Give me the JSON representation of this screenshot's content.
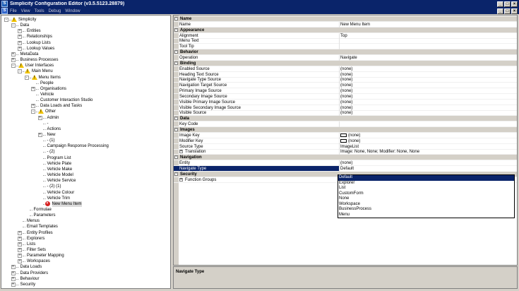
{
  "window": {
    "title": "Simplicity Configuration Editor (v3.5.5123.28879)",
    "menu": [
      "File",
      "View",
      "Tools",
      "Debug",
      "Window"
    ]
  },
  "tree": [
    {
      "label": "Simplicity",
      "indent": 0,
      "exp": "-",
      "icon": "warn"
    },
    {
      "label": "Data",
      "indent": 1,
      "exp": "-",
      "icon": ""
    },
    {
      "label": "Entities",
      "indent": 2,
      "exp": "+",
      "icon": ""
    },
    {
      "label": "Relationships",
      "indent": 2,
      "exp": "+",
      "icon": ""
    },
    {
      "label": "Lookup Lists",
      "indent": 2,
      "exp": "+",
      "icon": ""
    },
    {
      "label": "Lookup Values",
      "indent": 2,
      "exp": "+",
      "icon": ""
    },
    {
      "label": "MetaData",
      "indent": 1,
      "exp": "+",
      "icon": ""
    },
    {
      "label": "Business Processes",
      "indent": 1,
      "exp": "+",
      "icon": ""
    },
    {
      "label": "User Interfaces",
      "indent": 1,
      "exp": "-",
      "icon": "warn"
    },
    {
      "label": "Main Menu",
      "indent": 2,
      "exp": "-",
      "icon": "warn"
    },
    {
      "label": "Menu Items",
      "indent": 3,
      "exp": "-",
      "icon": "warn"
    },
    {
      "label": "People",
      "indent": 4,
      "exp": "",
      "icon": ""
    },
    {
      "label": "Organisations",
      "indent": 4,
      "exp": "+",
      "icon": ""
    },
    {
      "label": "Vehicle",
      "indent": 4,
      "exp": "",
      "icon": ""
    },
    {
      "label": "Customer Interaction Studio",
      "indent": 4,
      "exp": "",
      "icon": ""
    },
    {
      "label": "Data Loads and Tasks",
      "indent": 4,
      "exp": "+",
      "icon": ""
    },
    {
      "label": "Other",
      "indent": 4,
      "exp": "-",
      "icon": "warn"
    },
    {
      "label": "Admin",
      "indent": 5,
      "exp": "+",
      "icon": ""
    },
    {
      "label": "-",
      "indent": 5,
      "exp": "",
      "icon": ""
    },
    {
      "label": "Actions",
      "indent": 5,
      "exp": "",
      "icon": ""
    },
    {
      "label": "New",
      "indent": 5,
      "exp": "+",
      "icon": ""
    },
    {
      "label": "- (1)",
      "indent": 5,
      "exp": "",
      "icon": ""
    },
    {
      "label": "Campaign Response Processing",
      "indent": 5,
      "exp": "",
      "icon": ""
    },
    {
      "label": "- (2)",
      "indent": 5,
      "exp": "",
      "icon": ""
    },
    {
      "label": "Program List",
      "indent": 5,
      "exp": "",
      "icon": ""
    },
    {
      "label": "Vehicle Plate",
      "indent": 5,
      "exp": "",
      "icon": ""
    },
    {
      "label": "Vehicle Make",
      "indent": 5,
      "exp": "",
      "icon": ""
    },
    {
      "label": "Vehicle Model",
      "indent": 5,
      "exp": "",
      "icon": ""
    },
    {
      "label": "Vehicle Service",
      "indent": 5,
      "exp": "",
      "icon": ""
    },
    {
      "label": "- (2) (1)",
      "indent": 5,
      "exp": "",
      "icon": ""
    },
    {
      "label": "Vehicle Colour",
      "indent": 5,
      "exp": "",
      "icon": ""
    },
    {
      "label": "Vehicle Trim",
      "indent": 5,
      "exp": "",
      "icon": ""
    },
    {
      "label": "New Menu Item",
      "indent": 5,
      "exp": "",
      "icon": "err"
    },
    {
      "label": "Formulae",
      "indent": 3,
      "exp": "",
      "icon": ""
    },
    {
      "label": "Parameters",
      "indent": 3,
      "exp": "",
      "icon": ""
    },
    {
      "label": "Menus",
      "indent": 2,
      "exp": "",
      "icon": ""
    },
    {
      "label": "Email Templates",
      "indent": 2,
      "exp": "",
      "icon": ""
    },
    {
      "label": "Entity Profiles",
      "indent": 2,
      "exp": "+",
      "icon": ""
    },
    {
      "label": "Explorers",
      "indent": 2,
      "exp": "+",
      "icon": ""
    },
    {
      "label": "Lists",
      "indent": 2,
      "exp": "+",
      "icon": ""
    },
    {
      "label": "Filter Sets",
      "indent": 2,
      "exp": "+",
      "icon": ""
    },
    {
      "label": "Parameter Mapping",
      "indent": 2,
      "exp": "+",
      "icon": ""
    },
    {
      "label": "Workspaces",
      "indent": 2,
      "exp": "+",
      "icon": ""
    },
    {
      "label": "Data Loads",
      "indent": 1,
      "exp": "+",
      "icon": ""
    },
    {
      "label": "Data Providers",
      "indent": 1,
      "exp": "+",
      "icon": ""
    },
    {
      "label": "Behaviour",
      "indent": 1,
      "exp": "+",
      "icon": ""
    },
    {
      "label": "Security",
      "indent": 1,
      "exp": "+",
      "icon": ""
    }
  ],
  "grid": [
    {
      "type": "cat",
      "label": "Name"
    },
    {
      "type": "prop",
      "name": "Name",
      "value": "New Menu Item"
    },
    {
      "type": "cat",
      "label": "Appearance"
    },
    {
      "type": "prop",
      "name": "Alignment",
      "value": "Top"
    },
    {
      "type": "prop",
      "name": "Menu Text",
      "value": ""
    },
    {
      "type": "prop",
      "name": "Tool Tip",
      "value": ""
    },
    {
      "type": "cat",
      "label": "Behavior"
    },
    {
      "type": "prop",
      "name": "Operation",
      "value": "Navigate"
    },
    {
      "type": "cat",
      "label": "Binding"
    },
    {
      "type": "prop",
      "name": "Enabled Source",
      "value": "(none)"
    },
    {
      "type": "prop",
      "name": "Heading Text Source",
      "value": "(none)"
    },
    {
      "type": "prop",
      "name": "Navigate Type Source",
      "value": "(none)"
    },
    {
      "type": "prop",
      "name": "Navigation Target Source",
      "value": "(none)"
    },
    {
      "type": "prop",
      "name": "Primary Image Source",
      "value": "(none)"
    },
    {
      "type": "prop",
      "name": "Secondary Image Source",
      "value": "(none)"
    },
    {
      "type": "prop",
      "name": "Visible Primary Image Source",
      "value": "(none)"
    },
    {
      "type": "prop",
      "name": "Visible Secondary Image Source",
      "value": "(none)"
    },
    {
      "type": "prop",
      "name": "Visible Source",
      "value": "(none)"
    },
    {
      "type": "cat",
      "label": "Data"
    },
    {
      "type": "prop",
      "name": "Key Code",
      "value": ""
    },
    {
      "type": "cat",
      "label": "Images"
    },
    {
      "type": "prop",
      "name": "Image Key",
      "value": "(none)",
      "swatch": true
    },
    {
      "type": "prop",
      "name": "Modifier Key",
      "value": "(none)",
      "swatch": true
    },
    {
      "type": "prop",
      "name": "Source Type",
      "value": "ImageList"
    },
    {
      "type": "prop",
      "name": "Translation",
      "value": "Image: None, None; Modifier: None, None",
      "sub": true
    },
    {
      "type": "cat",
      "label": "Navigation"
    },
    {
      "type": "prop",
      "name": "Entity",
      "value": "(none)"
    },
    {
      "type": "prop",
      "name": "Navigate Type",
      "value": "Default",
      "highlight": true
    },
    {
      "type": "cat",
      "label": "Security"
    },
    {
      "type": "prop",
      "name": "Function Groups",
      "value": "",
      "sub": true
    }
  ],
  "dropdown": {
    "options": [
      "Default",
      "Explorer",
      "List",
      "CustomForm",
      "None",
      "Workspace",
      "BusinessProcess",
      "Menu"
    ],
    "selected": "Default"
  },
  "description": {
    "title": "Navigate Type"
  }
}
